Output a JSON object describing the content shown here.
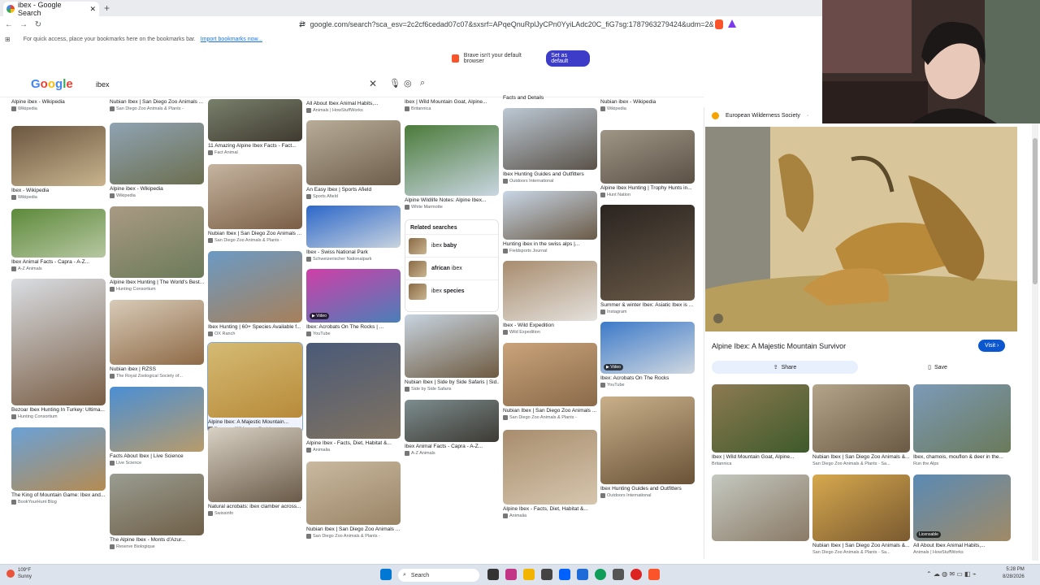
{
  "browser": {
    "tab_title": "ibex - Google Search",
    "url": "google.com/search?sca_esv=2c2cf6cedad07c07&sxsrf=APqeQnuRplJyCPn0YyiLAdc20C_fiG7sg:1787963279424&udm=2&fbs=ABfTbFVyMZGZf1hfvX9uKj...",
    "bookmarks_text": "For quick access, place your bookmarks here on the bookmarks bar.",
    "bookmarks_link": "Import bookmarks now...",
    "brave_text": "Brave isn't your default browser",
    "brave_button": "Set as default"
  },
  "search": {
    "logo": "Google",
    "query": "ibex"
  },
  "results": [
    {
      "title": "Alpine ibex - Wikipedia",
      "source": "Wikipedia"
    },
    {
      "title": "Ibex - Wikipedia",
      "source": "Wikipedia"
    },
    {
      "title": "Ibex Animal Facts - Capra - A-Z...",
      "source": "A-Z Animals"
    },
    {
      "title": "Bezoar Ibex Hunting In Turkey: Ultima...",
      "source": "Hunting Consortium"
    },
    {
      "title": "The King of Mountain Game: Ibex and...",
      "source": "BookYourHunt Blog"
    },
    {
      "title": "Nubian Ibex | San Diego Zoo Animals ...",
      "source": "San Diego Zoo Animals & Plants -"
    },
    {
      "title": "Alpine ibex - Wikipedia",
      "source": "Wikipedia"
    },
    {
      "title": "Alpine Ibex Hunting | The World's Best...",
      "source": "Hunting Consortium"
    },
    {
      "title": "Nubian ibex | RZSS",
      "source": "The Royal Zoological Society of..."
    },
    {
      "title": "Facts About Ibex | Live Science",
      "source": "Live Science"
    },
    {
      "title": "The Alpine Ibex - Monts d'Azur...",
      "source": "Reserve Biologique"
    },
    {
      "title": "11 Amazing Alpine Ibex Facts - Fact...",
      "source": "Fact Animal"
    },
    {
      "title": "Nubian Ibex | San Diego Zoo Animals ...",
      "source": "San Diego Zoo Animals & Plants -"
    },
    {
      "title": "Ibex Hunting | 60+ Species Available f...",
      "source": "OX Ranch"
    },
    {
      "title": "Alpine Ibex: A Majestic Mountain...",
      "source": "European Wilderness Society -"
    },
    {
      "title": "Natural acrobats: ibex clamber across...",
      "source": "Swissinfo"
    },
    {
      "title": "All About Ibex Animal Habits,...",
      "source": "Animals | HowStuffWorks"
    },
    {
      "title": "An Easy Ibex | Sports Afield",
      "source": "Sports Afield"
    },
    {
      "title": "Ibex - Swiss National Park",
      "source": "Schweizerischer Nationalpark"
    },
    {
      "title": "Ibex: Acrobats On The Rocks | ...",
      "source": "YouTube"
    },
    {
      "title": "Alpine Ibex - Facts, Diet, Habitat &...",
      "source": "Animalia"
    },
    {
      "title": "Nubian Ibex | San Diego Zoo Animals ...",
      "source": "San Diego Zoo Animals & Plants -"
    },
    {
      "title": "Ibex | Wild Mountain Goat, Alpine...",
      "source": "Britannica"
    },
    {
      "title": "Alpine Wildlife Notes: Alpine Ibex...",
      "source": "White Marmotte"
    },
    {
      "title": "Nubian Ibex | Side by Side Safaris | Sid...",
      "source": "Side by Side Safaris"
    },
    {
      "title": "Ibex Animal Facts - Capra - A-Z...",
      "source": "A-Z Animals"
    },
    {
      "title": "Facts and Details",
      "source": ""
    },
    {
      "title": "Ibex Hunting Guides and Outfitters",
      "source": "Outdoors International"
    },
    {
      "title": "Hunting ibex in the swiss alps |...",
      "source": "Fieldsports Journal"
    },
    {
      "title": "Ibex - Wild Expedition",
      "source": "Wild Expedition"
    },
    {
      "title": "Nubian Ibex | San Diego Zoo Animals ...",
      "source": "San Diego Zoo Animals & Plants -"
    },
    {
      "title": "Alpine Ibex - Facts, Diet, Habitat &...",
      "source": "Animalia"
    },
    {
      "title": "Nubian ibex - Wikipedia",
      "source": "Wikipedia"
    },
    {
      "title": "Alpine Ibex Hunting | Trophy Hunts in...",
      "source": "Hunt Nation"
    },
    {
      "title": "Summer & winter Ibex: Asiatic Ibex is ...",
      "source": "Instagram"
    },
    {
      "title": "Ibex: Acrobats On The Rocks",
      "source": "YouTube"
    },
    {
      "title": "Ibex Hunting Guides and Outfitters",
      "source": "Outdoors International"
    }
  ],
  "video_label": "Video",
  "related": {
    "title": "Related searches",
    "items": [
      {
        "pre": "ibex",
        "bold": "baby"
      },
      {
        "pre": "african",
        "bold": "ibex"
      },
      {
        "pre": "ibex",
        "bold": "species"
      }
    ]
  },
  "panel": {
    "site": "European Wilderness Society",
    "title": "Alpine Ibex: A Majestic Mountain Survivor",
    "visit": "Visit",
    "share": "Share",
    "save": "Save",
    "thumbs": [
      {
        "title": "Ibex | Wild Mountain Goat, Alpine...",
        "source": "Britannica"
      },
      {
        "title": "Nubian Ibex | San Diego Zoo Animals &...",
        "source": "San Diego Zoo Animals & Plants - Sa..."
      },
      {
        "title": "Ibex, chamois, mouflon & deer in the...",
        "source": "Run the Alps"
      },
      {
        "title": "",
        "source": ""
      },
      {
        "title": "Nubian Ibex | San Diego Zoo Animals &...",
        "source": "San Diego Zoo Animals & Plants - Sa..."
      },
      {
        "title": "All About Ibex Animal Habits,...",
        "source": "Animals | HowStuffWorks"
      }
    ],
    "licensable": "Licensable"
  },
  "taskbar": {
    "temp": "109°F",
    "weather": "Sunny",
    "search": "Search",
    "time": "5:28 PM",
    "date": "8/28/2026"
  },
  "colors": {
    "accent": "#0b57d0",
    "brave": "#3c3cc8"
  }
}
